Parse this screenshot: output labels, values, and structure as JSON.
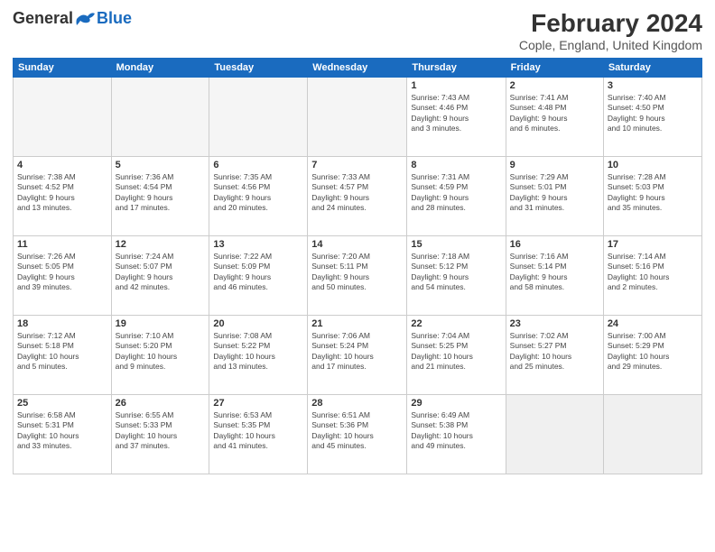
{
  "logo": {
    "general": "General",
    "blue": "Blue"
  },
  "title": {
    "month": "February 2024",
    "location": "Cople, England, United Kingdom"
  },
  "headers": [
    "Sunday",
    "Monday",
    "Tuesday",
    "Wednesday",
    "Thursday",
    "Friday",
    "Saturday"
  ],
  "weeks": [
    [
      {
        "day": "",
        "info": "",
        "empty": true
      },
      {
        "day": "",
        "info": "",
        "empty": true
      },
      {
        "day": "",
        "info": "",
        "empty": true
      },
      {
        "day": "",
        "info": "",
        "empty": true
      },
      {
        "day": "1",
        "info": "Sunrise: 7:43 AM\nSunset: 4:46 PM\nDaylight: 9 hours\nand 3 minutes."
      },
      {
        "day": "2",
        "info": "Sunrise: 7:41 AM\nSunset: 4:48 PM\nDaylight: 9 hours\nand 6 minutes."
      },
      {
        "day": "3",
        "info": "Sunrise: 7:40 AM\nSunset: 4:50 PM\nDaylight: 9 hours\nand 10 minutes."
      }
    ],
    [
      {
        "day": "4",
        "info": "Sunrise: 7:38 AM\nSunset: 4:52 PM\nDaylight: 9 hours\nand 13 minutes."
      },
      {
        "day": "5",
        "info": "Sunrise: 7:36 AM\nSunset: 4:54 PM\nDaylight: 9 hours\nand 17 minutes."
      },
      {
        "day": "6",
        "info": "Sunrise: 7:35 AM\nSunset: 4:56 PM\nDaylight: 9 hours\nand 20 minutes."
      },
      {
        "day": "7",
        "info": "Sunrise: 7:33 AM\nSunset: 4:57 PM\nDaylight: 9 hours\nand 24 minutes."
      },
      {
        "day": "8",
        "info": "Sunrise: 7:31 AM\nSunset: 4:59 PM\nDaylight: 9 hours\nand 28 minutes."
      },
      {
        "day": "9",
        "info": "Sunrise: 7:29 AM\nSunset: 5:01 PM\nDaylight: 9 hours\nand 31 minutes."
      },
      {
        "day": "10",
        "info": "Sunrise: 7:28 AM\nSunset: 5:03 PM\nDaylight: 9 hours\nand 35 minutes."
      }
    ],
    [
      {
        "day": "11",
        "info": "Sunrise: 7:26 AM\nSunset: 5:05 PM\nDaylight: 9 hours\nand 39 minutes."
      },
      {
        "day": "12",
        "info": "Sunrise: 7:24 AM\nSunset: 5:07 PM\nDaylight: 9 hours\nand 42 minutes."
      },
      {
        "day": "13",
        "info": "Sunrise: 7:22 AM\nSunset: 5:09 PM\nDaylight: 9 hours\nand 46 minutes."
      },
      {
        "day": "14",
        "info": "Sunrise: 7:20 AM\nSunset: 5:11 PM\nDaylight: 9 hours\nand 50 minutes."
      },
      {
        "day": "15",
        "info": "Sunrise: 7:18 AM\nSunset: 5:12 PM\nDaylight: 9 hours\nand 54 minutes."
      },
      {
        "day": "16",
        "info": "Sunrise: 7:16 AM\nSunset: 5:14 PM\nDaylight: 9 hours\nand 58 minutes."
      },
      {
        "day": "17",
        "info": "Sunrise: 7:14 AM\nSunset: 5:16 PM\nDaylight: 10 hours\nand 2 minutes."
      }
    ],
    [
      {
        "day": "18",
        "info": "Sunrise: 7:12 AM\nSunset: 5:18 PM\nDaylight: 10 hours\nand 5 minutes."
      },
      {
        "day": "19",
        "info": "Sunrise: 7:10 AM\nSunset: 5:20 PM\nDaylight: 10 hours\nand 9 minutes."
      },
      {
        "day": "20",
        "info": "Sunrise: 7:08 AM\nSunset: 5:22 PM\nDaylight: 10 hours\nand 13 minutes."
      },
      {
        "day": "21",
        "info": "Sunrise: 7:06 AM\nSunset: 5:24 PM\nDaylight: 10 hours\nand 17 minutes."
      },
      {
        "day": "22",
        "info": "Sunrise: 7:04 AM\nSunset: 5:25 PM\nDaylight: 10 hours\nand 21 minutes."
      },
      {
        "day": "23",
        "info": "Sunrise: 7:02 AM\nSunset: 5:27 PM\nDaylight: 10 hours\nand 25 minutes."
      },
      {
        "day": "24",
        "info": "Sunrise: 7:00 AM\nSunset: 5:29 PM\nDaylight: 10 hours\nand 29 minutes."
      }
    ],
    [
      {
        "day": "25",
        "info": "Sunrise: 6:58 AM\nSunset: 5:31 PM\nDaylight: 10 hours\nand 33 minutes."
      },
      {
        "day": "26",
        "info": "Sunrise: 6:55 AM\nSunset: 5:33 PM\nDaylight: 10 hours\nand 37 minutes."
      },
      {
        "day": "27",
        "info": "Sunrise: 6:53 AM\nSunset: 5:35 PM\nDaylight: 10 hours\nand 41 minutes."
      },
      {
        "day": "28",
        "info": "Sunrise: 6:51 AM\nSunset: 5:36 PM\nDaylight: 10 hours\nand 45 minutes."
      },
      {
        "day": "29",
        "info": "Sunrise: 6:49 AM\nSunset: 5:38 PM\nDaylight: 10 hours\nand 49 minutes."
      },
      {
        "day": "",
        "info": "",
        "empty": true
      },
      {
        "day": "",
        "info": "",
        "empty": true
      }
    ]
  ]
}
